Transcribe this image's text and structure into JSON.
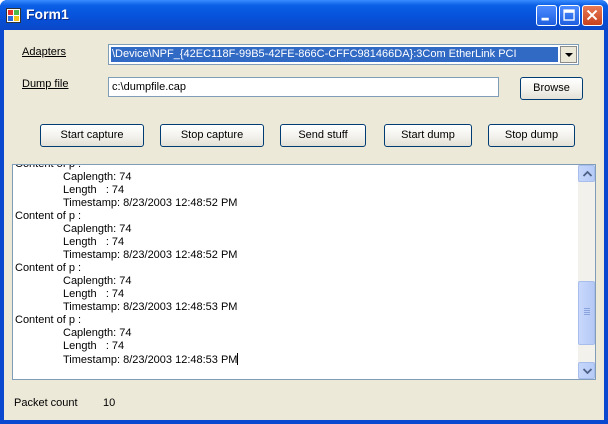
{
  "window": {
    "title": "Form1",
    "icon": "windows-form-icon",
    "controls": {
      "minimize": "minimize-icon",
      "maximize": "maximize-icon",
      "close": "close-icon"
    }
  },
  "form": {
    "adapters_label": "Adapters",
    "adapters_value": "\\Device\\NPF_{42EC118F-99B5-42FE-866C-CFFC981466DA}:3Com EtherLink PCI",
    "dump_file_label": "Dump file",
    "dump_file_value": "c:\\dumpfile.cap",
    "browse_label": "Browse"
  },
  "toolbar": {
    "start_capture": "Start capture",
    "stop_capture": "Stop capture",
    "send_stuff": "Send stuff",
    "start_dump": "Start dump",
    "stop_dump": "Stop dump"
  },
  "log": {
    "lines": [
      {
        "text": "Content of p :",
        "indent": false
      },
      {
        "text": "Caplength: 74",
        "indent": true
      },
      {
        "text": "Length   : 74",
        "indent": true
      },
      {
        "text": "Timestamp: 8/23/2003 12:48:52 PM",
        "indent": true
      },
      {
        "text": "Content of p :",
        "indent": false
      },
      {
        "text": "Caplength: 74",
        "indent": true
      },
      {
        "text": "Length   : 74",
        "indent": true
      },
      {
        "text": "Timestamp: 8/23/2003 12:48:52 PM",
        "indent": true
      },
      {
        "text": "Content of p :",
        "indent": false
      },
      {
        "text": "Caplength: 74",
        "indent": true
      },
      {
        "text": "Length   : 74",
        "indent": true
      },
      {
        "text": "Timestamp: 8/23/2003 12:48:53 PM",
        "indent": true
      },
      {
        "text": "Content of p :",
        "indent": false
      },
      {
        "text": "Caplength: 74",
        "indent": true
      },
      {
        "text": "Length   : 74",
        "indent": true
      },
      {
        "text": "Timestamp: 8/23/2003 12:48:53 PM",
        "indent": true
      }
    ],
    "scroll_position": 0.85
  },
  "status": {
    "packet_count_label": "Packet count",
    "packet_count_value": "10"
  },
  "colors": {
    "titlebar": "#0a5fe6",
    "client_bg": "#ece9d8",
    "selection": "#316ac5",
    "close_button": "#d4502a"
  }
}
